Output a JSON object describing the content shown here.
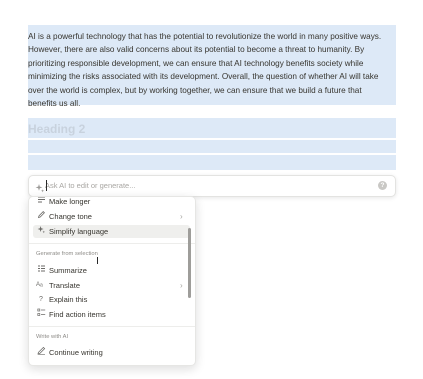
{
  "document": {
    "paragraph": "AI is a powerful technology that has the potential to revolutionize the world in many positive ways. However, there are also valid concerns about its potential to become a threat to humanity. By prioritizing responsible development, we can ensure that AI technology benefits society while minimizing the risks associated with its development. Overall, the question of whether AI will take over the world is complex, but by working together, we can ensure that we build a future that benefits us all.",
    "heading": "Heading 2"
  },
  "ai_bar": {
    "placeholder": "Ask AI to edit or generate...",
    "icon": "sparkle-icon",
    "help_icon": "help-icon",
    "help_glyph": "?"
  },
  "menu": {
    "items_top": [
      {
        "label": "Make longer",
        "icon": "make-longer-icon"
      },
      {
        "label": "Change tone",
        "icon": "pen-icon",
        "has_submenu": true
      },
      {
        "label": "Simplify language",
        "icon": "sparkle-icon",
        "highlighted": true
      }
    ],
    "section_generate": "Generate from selection",
    "items_generate": [
      {
        "label": "Summarize",
        "icon": "summarize-icon"
      },
      {
        "label": "Translate",
        "icon": "translate-icon",
        "has_submenu": true
      },
      {
        "label": "Explain this",
        "icon": "question-icon"
      },
      {
        "label": "Find action items",
        "icon": "checklist-icon"
      }
    ],
    "section_write": "Write with AI",
    "items_write": [
      {
        "label": "Continue writing",
        "icon": "pencil-icon"
      }
    ]
  },
  "colors": {
    "selection": "#dde9f7",
    "hover": "#efefed",
    "text": "#37352f",
    "muted": "#8e8c88"
  }
}
